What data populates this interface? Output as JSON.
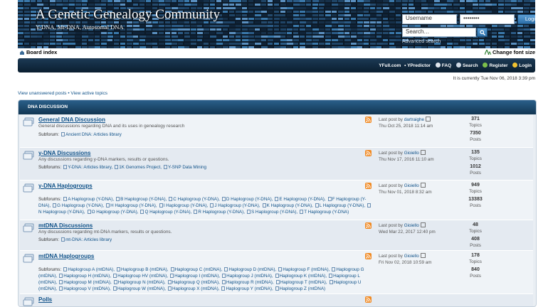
{
  "header": {
    "site_title": "A Genetic Genealogy Community",
    "site_desc": "Y-DNA, Mt-DNA, Autosomal DNA",
    "username_value": "Username",
    "password_value": "••••••••",
    "login_label": "Login",
    "search_placeholder": "Search…",
    "advanced_search": "Advanced search"
  },
  "breadcrumb": {
    "board_index": "Board index",
    "change_font": "Change font size"
  },
  "navbar": {
    "yfull": "YFull.com",
    "ypredictor": "• YPredictor",
    "faq": "FAQ",
    "search": "Search",
    "register": "Register",
    "login": "Login"
  },
  "current_time": "It is currently Tue Nov 06, 2018 3:39 pm",
  "view_links": "View unanswered posts • View active topics",
  "category": "DNA Discussion",
  "forums": [
    {
      "title": "General DNA Discussion",
      "desc": "General discussions regarding DNA and its uses in genealogy research",
      "sub_label": "Subforum:",
      "subforums": [
        "Ancient DNA: Articles library"
      ],
      "last_by": "dartraighe",
      "last_date": "Thu Oct 25, 2018 11:14 am",
      "topics": "371",
      "posts": "7350"
    },
    {
      "title": "y-DNA Discussions",
      "desc": "Any discussions regarding y-DNA markers, results or questions.",
      "sub_label": "Subforums:",
      "subforums": [
        "Y-DNA: Articles library",
        "1K Genomes Project",
        "Y-SNP Data Mining"
      ],
      "last_by": "Gioiello",
      "last_date": "Thu Nov 17, 2016 11:10 am",
      "topics": "135",
      "posts": "1012"
    },
    {
      "title": "y-DNA Haplogroups",
      "desc": "",
      "sub_label": "Subforums:",
      "subforums": [
        "A Haplogroup (Y-DNA)",
        "B Haplogroup (Y-DNA)",
        "C Haplogroup (Y-DNA)",
        "D Haplogroup (Y-DNA)",
        "E Haplogroup (Y-DNA)",
        "F Haplogroup (Y-DNA)",
        "G Haplogroup (Y-DNA)",
        "H Haplogroup (Y-DNA)",
        "I Haplogroup (Y-DNA)",
        "J Haplogroup (Y-DNA)",
        "K Haplogroup (Y-DNA)",
        "L Haplogroup (Y-DNA)",
        "N Haplogroup (Y-DNA)",
        "O Haplogroup (Y-DNA)",
        "Q Haplogroup (Y-DNA)",
        "R Haplogroup (Y-DNA)",
        "S Haplogroup (Y-DNA)",
        "T Haplogroup (Y-DNA)"
      ],
      "last_by": "Gioiello",
      "last_date": "Thu Nov 01, 2018 8:32 am",
      "topics": "949",
      "posts": "13383"
    },
    {
      "title": "mtDNA Discussions",
      "desc": "Any discussions regarding mt-DNA markers, results or questions.",
      "sub_label": "Subforum:",
      "subforums": [
        "mt-DNA: Articles library"
      ],
      "last_by": "Gioiello",
      "last_date": "Wed Mar 22, 2017 12:40 pm",
      "topics": "48",
      "posts": "408"
    },
    {
      "title": "mtDNA Haplogroups",
      "desc": "",
      "sub_label": "Subforums:",
      "subforums": [
        "Haplogroup A (mtDNA)",
        "Haplogroup B (mtDNA)",
        "Haplogroup C (mtDNA)",
        "Haplogroup D (mtDNA)",
        "Haplogroup F (mtDNA)",
        "Haplogroup G (mtDNA)",
        "Haplogroup H (mtDNA)",
        "Haplogroup HV (mtDNA)",
        "Haplogroup I (mtDNA)",
        "Haplogroup J (mtDNA)",
        "Haplogroup K (mtDNA)",
        "Haplogroup L (mtDNA)",
        "Haplogroup M (mtDNA)",
        "Haplogroup N (mtDNA)",
        "Haplogroup Q (mtDNA)",
        "Haplogroup R (mtDNA)",
        "Haplogroup T (mtDNA)",
        "Haplogroup U (mtDNA)",
        "Haplogroup V (mtDNA)",
        "Haplogroup W (mtDNA)",
        "Haplogroup X (mtDNA)",
        "Haplogroup Y (mtDNA)",
        "Haplogroup Z (mtDNA)"
      ],
      "last_by": "Gioiello",
      "last_date": "Fri Nov 02, 2018 10:59 am",
      "topics": "178",
      "posts": "840"
    },
    {
      "title": "Polls",
      "desc": "",
      "sub_label": "",
      "subforums": [],
      "last_by": "",
      "last_date": "",
      "topics": "",
      "posts": ""
    }
  ],
  "labels": {
    "last_post_by": "Last post by",
    "topics": "Topics",
    "posts": "Posts"
  },
  "colors": {
    "header_bg": "#0c1a28",
    "link": "#105289",
    "category_head": "#123652"
  }
}
